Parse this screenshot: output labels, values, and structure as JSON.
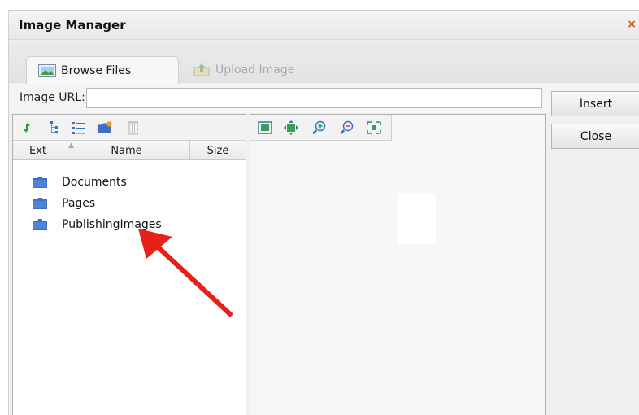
{
  "dialog": {
    "title": "Image Manager",
    "close_glyph": "×"
  },
  "tabs": [
    {
      "label": "Browse Files",
      "icon": "image-icon",
      "active": true
    },
    {
      "label": "Upload Image",
      "icon": "upload-icon",
      "active": false
    }
  ],
  "url": {
    "label": "Image URL:",
    "value": "",
    "placeholder": ""
  },
  "buttons": {
    "insert": "Insert",
    "close": "Close"
  },
  "file_toolbar": [
    "refresh-icon",
    "tree-view-icon",
    "list-view-icon",
    "new-folder-icon",
    "delete-icon"
  ],
  "preview_toolbar": [
    "fit-icon",
    "actual-size-icon",
    "zoom-in-icon",
    "zoom-out-icon",
    "best-fit-icon"
  ],
  "columns": {
    "ext": "Ext",
    "name": "Name",
    "size": "Size"
  },
  "files": [
    {
      "name": "Documents",
      "type": "folder"
    },
    {
      "name": "Pages",
      "type": "folder"
    },
    {
      "name": "PublishingImages",
      "type": "folder"
    }
  ],
  "colors": {
    "arrow": "#e8201a",
    "folder": "#3d6fc4",
    "close_x": "#d9531e"
  }
}
